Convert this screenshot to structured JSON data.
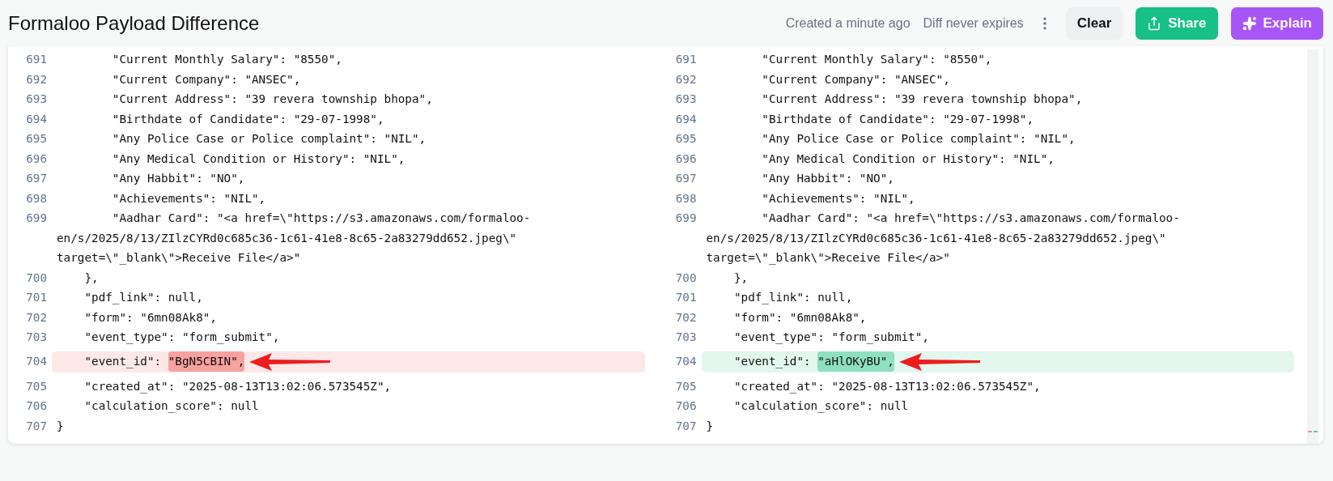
{
  "header": {
    "title": "Formaloo Payload Difference",
    "created": "Created a minute ago",
    "expiry": "Diff never expires",
    "buttons": [
      {
        "kind": "clear",
        "label": "Clear"
      },
      {
        "kind": "share",
        "label": "Share"
      },
      {
        "kind": "explain",
        "label": "Explain"
      }
    ]
  },
  "panes": [
    {
      "lines": [
        {
          "number": "691",
          "kind": "plain",
          "rows": [
            "        \"Current Monthly Salary\": \"8550\","
          ]
        },
        {
          "number": "692",
          "kind": "plain",
          "rows": [
            "        \"Current Company\": \"ANSEC\","
          ]
        },
        {
          "number": "693",
          "kind": "plain",
          "rows": [
            "        \"Current Address\": \"39 revera township bhopa\","
          ]
        },
        {
          "number": "694",
          "kind": "plain",
          "rows": [
            "        \"Birthdate of Candidate\": \"29-07-1998\","
          ]
        },
        {
          "number": "695",
          "kind": "plain",
          "rows": [
            "        \"Any Police Case or Police complaint\": \"NIL\","
          ]
        },
        {
          "number": "696",
          "kind": "plain",
          "rows": [
            "        \"Any Medical Condition or History\": \"NIL\","
          ]
        },
        {
          "number": "697",
          "kind": "plain",
          "rows": [
            "        \"Any Habbit\": \"NO\","
          ]
        },
        {
          "number": "698",
          "kind": "plain",
          "rows": [
            "        \"Achievements\": \"NIL\","
          ]
        },
        {
          "number": "699",
          "kind": "plain",
          "rows": [
            "        \"Aadhar Card\": \"<a href=\\\"https://s3.amazonaws.com/formaloo-",
            "en/s/2025/8/13/ZIlzCYRd0c685c36-1c61-41e8-8c65-2a83279dd652.jpeg\\\"",
            "target=\\\"_blank\\\">Receive File</a>\""
          ]
        },
        {
          "number": "700",
          "kind": "plain",
          "rows": [
            "    },"
          ]
        },
        {
          "number": "701",
          "kind": "plain",
          "rows": [
            "    \"pdf_link\": null,"
          ]
        },
        {
          "number": "702",
          "kind": "plain",
          "rows": [
            "    \"form\": \"6mn08Ak8\","
          ]
        },
        {
          "number": "703",
          "kind": "plain",
          "rows": [
            "    \"event_type\": \"form_submit\","
          ]
        },
        {
          "number": "704",
          "kind": "removed",
          "prefix": "    \"event_id\": ",
          "changed": "\"BgN5CBIN\","
        },
        {
          "number": "705",
          "kind": "plain",
          "rows": [
            "    \"created_at\": \"2025-08-13T13:02:06.573545Z\","
          ]
        },
        {
          "number": "706",
          "kind": "plain",
          "rows": [
            "    \"calculation_score\": null"
          ]
        },
        {
          "number": "707",
          "kind": "plain",
          "rows": [
            "}"
          ]
        }
      ]
    },
    {
      "lines": [
        {
          "number": "691",
          "kind": "plain",
          "rows": [
            "        \"Current Monthly Salary\": \"8550\","
          ]
        },
        {
          "number": "692",
          "kind": "plain",
          "rows": [
            "        \"Current Company\": \"ANSEC\","
          ]
        },
        {
          "number": "693",
          "kind": "plain",
          "rows": [
            "        \"Current Address\": \"39 revera township bhopa\","
          ]
        },
        {
          "number": "694",
          "kind": "plain",
          "rows": [
            "        \"Birthdate of Candidate\": \"29-07-1998\","
          ]
        },
        {
          "number": "695",
          "kind": "plain",
          "rows": [
            "        \"Any Police Case or Police complaint\": \"NIL\","
          ]
        },
        {
          "number": "696",
          "kind": "plain",
          "rows": [
            "        \"Any Medical Condition or History\": \"NIL\","
          ]
        },
        {
          "number": "697",
          "kind": "plain",
          "rows": [
            "        \"Any Habbit\": \"NO\","
          ]
        },
        {
          "number": "698",
          "kind": "plain",
          "rows": [
            "        \"Achievements\": \"NIL\","
          ]
        },
        {
          "number": "699",
          "kind": "plain",
          "rows": [
            "        \"Aadhar Card\": \"<a href=\\\"https://s3.amazonaws.com/formaloo-",
            "en/s/2025/8/13/ZIlzCYRd0c685c36-1c61-41e8-8c65-2a83279dd652.jpeg\\\"",
            "target=\\\"_blank\\\">Receive File</a>\""
          ]
        },
        {
          "number": "700",
          "kind": "plain",
          "rows": [
            "    },"
          ]
        },
        {
          "number": "701",
          "kind": "plain",
          "rows": [
            "    \"pdf_link\": null,"
          ]
        },
        {
          "number": "702",
          "kind": "plain",
          "rows": [
            "    \"form\": \"6mn08Ak8\","
          ]
        },
        {
          "number": "703",
          "kind": "plain",
          "rows": [
            "    \"event_type\": \"form_submit\","
          ]
        },
        {
          "number": "704",
          "kind": "added",
          "prefix": "    \"event_id\": ",
          "changed": "\"aHlOKyBU\","
        },
        {
          "number": "705",
          "kind": "plain",
          "rows": [
            "    \"created_at\": \"2025-08-13T13:02:06.573545Z\","
          ]
        },
        {
          "number": "706",
          "kind": "plain",
          "rows": [
            "    \"calculation_score\": null"
          ]
        },
        {
          "number": "707",
          "kind": "plain",
          "rows": [
            "}"
          ]
        }
      ]
    }
  ]
}
